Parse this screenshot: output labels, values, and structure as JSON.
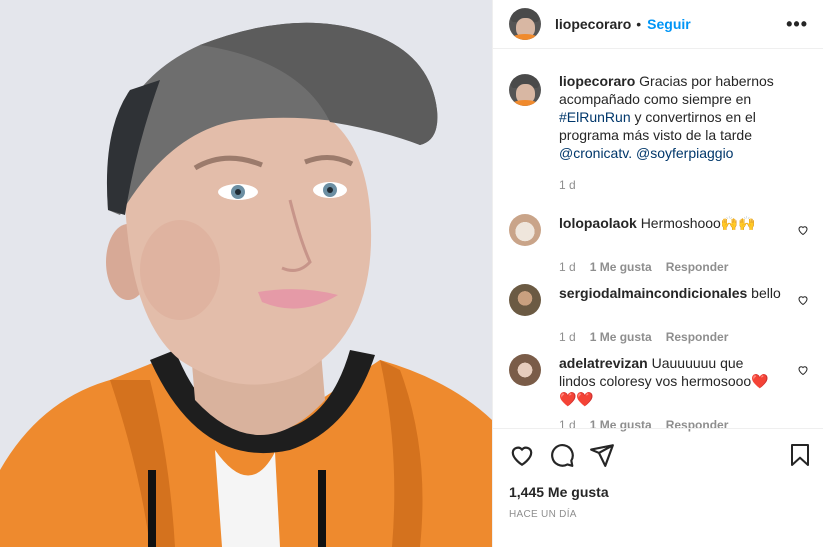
{
  "post": {
    "username": "liopecoraro",
    "separator": "•",
    "follow_label": "Seguir",
    "more_icon": "more-options-icon",
    "caption": {
      "part1": "Gracias por habernos acompañado como siempre en ",
      "hashtag": "#ElRunRun",
      "part2": " y convertirnos en el programa más visto de la tarde ",
      "mention1": "@cronicatv.",
      "space": " ",
      "mention2": "@soyferpiaggio",
      "time": "1 d"
    },
    "comments": [
      {
        "user": "lolopaolaok",
        "text": "Hermoshooo",
        "emoji": "🙌🙌",
        "time": "1 d",
        "likes": "1 Me gusta",
        "reply": "Responder"
      },
      {
        "user": "sergiodalmaincondicionales",
        "text": "bello",
        "emoji": "",
        "time": "1 d",
        "likes": "1 Me gusta",
        "reply": "Responder"
      },
      {
        "user": "adelatrevizan",
        "text": "Uauuuuuu que lindos coloresy vos hermosooo",
        "emoji": "❤️❤️❤️",
        "time": "1 d",
        "likes": "1 Me gusta",
        "reply": "Responder"
      }
    ],
    "like_count": "1,445 Me gusta",
    "posted_ago": "Hace un día",
    "colors": {
      "accent": "#0095f6",
      "link": "#00376b",
      "muted": "#8e8e8e",
      "hoodie": "#f08a2d"
    }
  }
}
